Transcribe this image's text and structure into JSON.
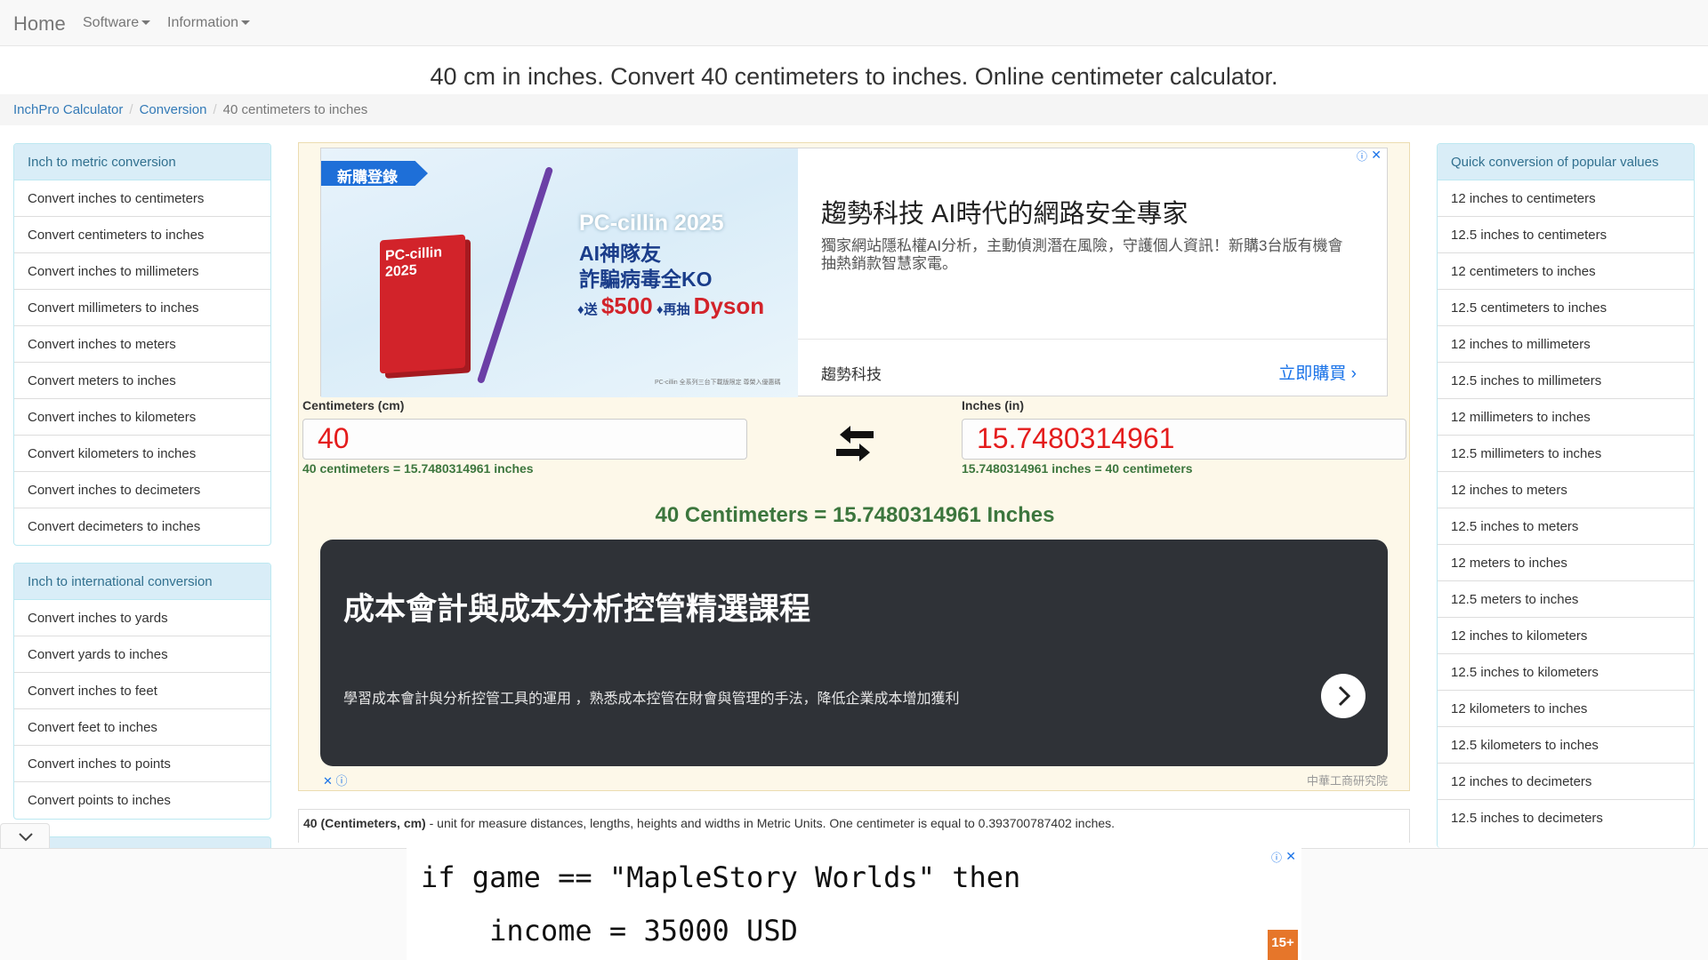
{
  "nav": {
    "home": "Home",
    "items": [
      "Software",
      "Information"
    ]
  },
  "page_title": "40 cm in inches. Convert 40 centimeters to inches. Online centimeter calculator.",
  "breadcrumb": {
    "items": [
      "InchPro Calculator",
      "Conversion"
    ],
    "current": "40 centimeters to inches"
  },
  "left_panels": [
    {
      "title": "Inch to metric conversion",
      "items": [
        "Convert inches to centimeters",
        "Convert centimeters to inches",
        "Convert inches to millimeters",
        "Convert millimeters to inches",
        "Convert inches to meters",
        "Convert meters to inches",
        "Convert inches to kilometers",
        "Convert kilometers to inches",
        "Convert inches to decimeters",
        "Convert decimeters to inches"
      ]
    },
    {
      "title": "Inch to international conversion",
      "items": [
        "Convert inches to yards",
        "Convert yards to inches",
        "Convert inches to feet",
        "Convert feet to inches",
        "Convert inches to points",
        "Convert points to inches"
      ]
    }
  ],
  "right_panel": {
    "title": "Quick conversion of popular values",
    "items": [
      "12 inches to centimeters",
      "12.5 inches to centimeters",
      "12 centimeters to inches",
      "12.5 centimeters to inches",
      "12 inches to millimeters",
      "12.5 inches to millimeters",
      "12 millimeters to inches",
      "12.5 millimeters to inches",
      "12 inches to meters",
      "12.5 inches to meters",
      "12 meters to inches",
      "12.5 meters to inches",
      "12 inches to kilometers",
      "12.5 inches to kilometers",
      "12 kilometers to inches",
      "12.5 kilometers to inches",
      "12 inches to decimeters",
      "12.5 inches to decimeters"
    ]
  },
  "converter": {
    "left_label": "Centimeters (cm)",
    "left_value": "40",
    "left_note": "40 centimeters = 15.7480314961 inches",
    "right_label": "Inches (in)",
    "right_value": "15.7480314961",
    "right_note": "15.7480314961 inches = 40 centimeters",
    "result": "40 Centimeters = 15.7480314961 Inches",
    "swap_icon": "swap-arrows-icon"
  },
  "ad_top": {
    "badge": "新購登錄",
    "box_text": "PC-cillin 2025",
    "product": "PC-cillin 2025",
    "headline_1": "AI神隊友",
    "headline_2": "詐騙病毒全KO",
    "offer_prefix": "♦送",
    "offer_price": "$500",
    "offer_mid": "♦再抽",
    "offer_brand": "Dyson",
    "fine_print": "PC-cillin 全系列三台下載版限定 尊榮入優惠碼",
    "title": "趨勢科技 AI時代的網路安全專家",
    "description": "獨家網站隱私權AI分析，主動偵測潛在風險，守護個人資訊！新購3台版有機會抽熱銷款智慧家電。",
    "advertiser": "趨勢科技",
    "cta": "立即購買"
  },
  "ad_middle": {
    "title": "成本會計與成本分析控管精選課程",
    "description": "學習成本會計與分析控管工具的運用 ，熟悉成本控管在財會與管理的手法，降低企業成本增加獲利",
    "source": "中華工商研究院"
  },
  "description": {
    "bold": "40 (Centimeters, cm)",
    "text": " - unit for measure distances, lengths, heights and widths in Metric Units. One centimeter is equal to 0.393700787402 inches."
  },
  "anchor_ad": {
    "line1": "if game == \"MapleStory Worlds\" then",
    "line2": "    income = 35000 USD",
    "logo": "15+"
  },
  "colors": {
    "link": "#337ab7",
    "panel_head_bg": "#d9edf7",
    "result_green": "#3c763d",
    "input_red": "#e41c1c"
  }
}
